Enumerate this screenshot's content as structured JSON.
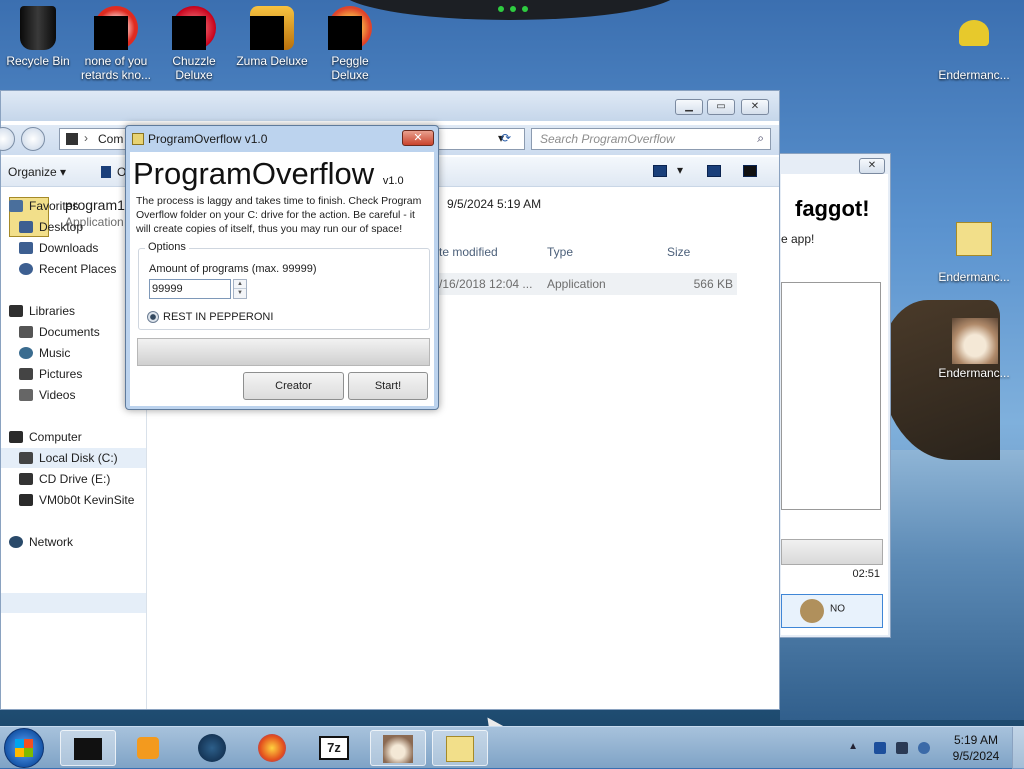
{
  "desktop": {
    "icons": [
      {
        "label": "Recycle Bin"
      },
      {
        "label": "none of you retards kno..."
      },
      {
        "label": "Chuzzle Deluxe"
      },
      {
        "label": "Zuma Deluxe"
      },
      {
        "label": "Peggle Deluxe"
      },
      {
        "label": "Endermanc..."
      },
      {
        "label": "Endermanc..."
      },
      {
        "label": "Endermanc..."
      }
    ]
  },
  "explorer": {
    "address": "Com",
    "search_placeholder": "Search ProgramOverflow",
    "toolbar": {
      "organize": "Organize",
      "open": "O"
    },
    "selected": {
      "name": "program1",
      "type_label": "Application",
      "date_modified": "9/5/2024 5:19 AM"
    },
    "nav": {
      "favorites": "Favorites",
      "desktop": "Desktop",
      "downloads": "Downloads",
      "recent": "Recent Places",
      "libraries": "Libraries",
      "documents": "Documents",
      "music": "Music",
      "pictures": "Pictures",
      "videos": "Videos",
      "computer": "Computer",
      "local_disk": "Local Disk (C:)",
      "cd_drive": "CD Drive (E:)",
      "vm": "VM0b0t KevinSite",
      "network": "Network"
    },
    "columns": {
      "date": "te modified",
      "type": "Type",
      "size": "Size"
    },
    "row": {
      "date": "/16/2018 12:04 ...",
      "type": "Application",
      "size": "566 KB"
    }
  },
  "behind_dialog": {
    "headline": "faggot!",
    "subtext": "e app!",
    "timer": "02:51",
    "no_label": "NO"
  },
  "dialog": {
    "title": "ProgramOverflow v1.0",
    "close": "✕",
    "heading": "ProgramOverflow",
    "version": "v1.0",
    "description": "The process is laggy and takes time to finish. Check Program Overflow folder on your C: drive for the action. Be careful - it will create copies of itself, thus you may run our of space!",
    "options_legend": "Options",
    "amount_label": "Amount of programs (max. 99999)",
    "amount_value": "99999",
    "radio_label": "REST IN PEPPERONI",
    "progress": 0,
    "creator_button": "Creator",
    "start_button": "Start!"
  },
  "taskbar": {
    "time": "5:19 AM",
    "date": "9/5/2024"
  },
  "colors": {
    "dialog_frame": "#bcd3ee",
    "taskbar": "#8fb1d2",
    "selection": "#e5eef8"
  }
}
